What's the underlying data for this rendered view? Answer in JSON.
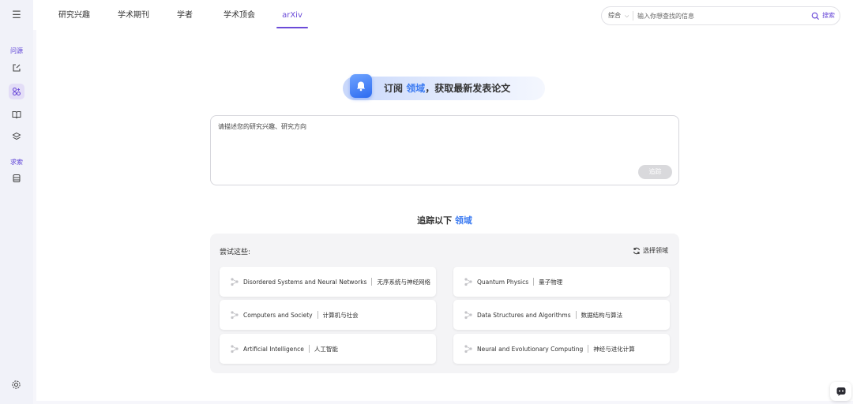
{
  "sidebar": {
    "section_ask": "问源",
    "section_search": "求索"
  },
  "nav": {
    "tabs": [
      {
        "label": "研究兴趣"
      },
      {
        "label": "学术期刊"
      },
      {
        "label": "学者"
      },
      {
        "label": "学术顶会"
      },
      {
        "label": "arXiv"
      }
    ],
    "active_index": 4
  },
  "search": {
    "scope": "综合",
    "placeholder": "输入你想查找的信息",
    "button_label": "搜索"
  },
  "banner": {
    "prefix": "订阅 ",
    "highlight": "领域",
    "suffix": "，获取最新发表论文"
  },
  "interest_input": {
    "placeholder": "请描述您的研究兴趣、研究方向",
    "button_label": "追踪"
  },
  "tracking": {
    "title_prefix": "追踪以下 ",
    "title_highlight": "领域",
    "try_label": "尝试这些:",
    "select_label": "选择领域",
    "items": [
      {
        "en": "Disordered Systems and Neural Networks",
        "zh": "无序系统与神经网络"
      },
      {
        "en": "Quantum Physics",
        "zh": "量子物理"
      },
      {
        "en": "Computers and Society",
        "zh": "计算机与社会"
      },
      {
        "en": "Data Structures and Algorithms",
        "zh": "数据结构与算法"
      },
      {
        "en": "Artificial Intelligence",
        "zh": "人工智能"
      },
      {
        "en": "Neural and Evolutionary Computing",
        "zh": "神经与进化计算"
      }
    ]
  },
  "colors": {
    "accent": "#6b4bd8",
    "highlight": "#3d7cf2"
  }
}
